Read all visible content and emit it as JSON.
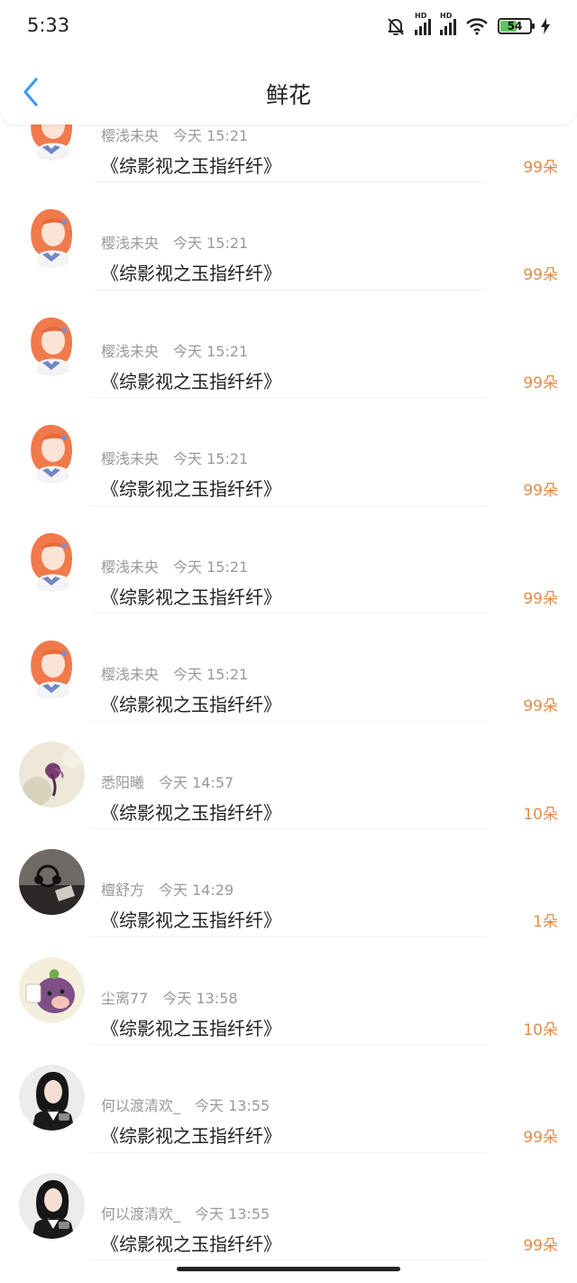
{
  "status_bar": {
    "time": "5:33",
    "battery": "54",
    "signal_label": "HD"
  },
  "header": {
    "title": "鲜花"
  },
  "rows": [
    {
      "name": "樱浅未央",
      "time": "今天 15:21",
      "book": "《综影视之玉指纤纤》",
      "count": "99朵",
      "avatar": "avatar-girl-red-hair"
    },
    {
      "name": "樱浅未央",
      "time": "今天 15:21",
      "book": "《综影视之玉指纤纤》",
      "count": "99朵",
      "avatar": "avatar-girl-red-hair"
    },
    {
      "name": "樱浅未央",
      "time": "今天 15:21",
      "book": "《综影视之玉指纤纤》",
      "count": "99朵",
      "avatar": "avatar-girl-red-hair"
    },
    {
      "name": "樱浅未央",
      "time": "今天 15:21",
      "book": "《综影视之玉指纤纤》",
      "count": "99朵",
      "avatar": "avatar-girl-red-hair"
    },
    {
      "name": "樱浅未央",
      "time": "今天 15:21",
      "book": "《综影视之玉指纤纤》",
      "count": "99朵",
      "avatar": "avatar-girl-red-hair"
    },
    {
      "name": "樱浅未央",
      "time": "今天 15:21",
      "book": "《综影视之玉指纤纤》",
      "count": "99朵",
      "avatar": "avatar-girl-red-hair"
    },
    {
      "name": "悉阳曦",
      "time": "今天 14:57",
      "book": "《综影视之玉指纤纤》",
      "count": "10朵",
      "avatar": "avatar-purple-flower"
    },
    {
      "name": "檀舒方",
      "time": "今天 14:29",
      "book": "《综影视之玉指纤纤》",
      "count": "1朵",
      "avatar": "avatar-dark-headphones"
    },
    {
      "name": "尘离77",
      "time": "今天 13:58",
      "book": "《综影视之玉指纤纤》",
      "count": "10朵",
      "avatar": "avatar-cartoon-character"
    },
    {
      "name": "何以渡清欢_",
      "time": "今天 13:55",
      "book": "《综影视之玉指纤纤》",
      "count": "99朵",
      "avatar": "avatar-woman-portrait"
    },
    {
      "name": "何以渡清欢_",
      "time": "今天 13:55",
      "book": "《综影视之玉指纤纤》",
      "count": "99朵",
      "avatar": "avatar-woman-portrait"
    }
  ],
  "colors": {
    "count": "#e58b4a",
    "back_icon": "#3d9be9",
    "meta_text": "#999999"
  }
}
